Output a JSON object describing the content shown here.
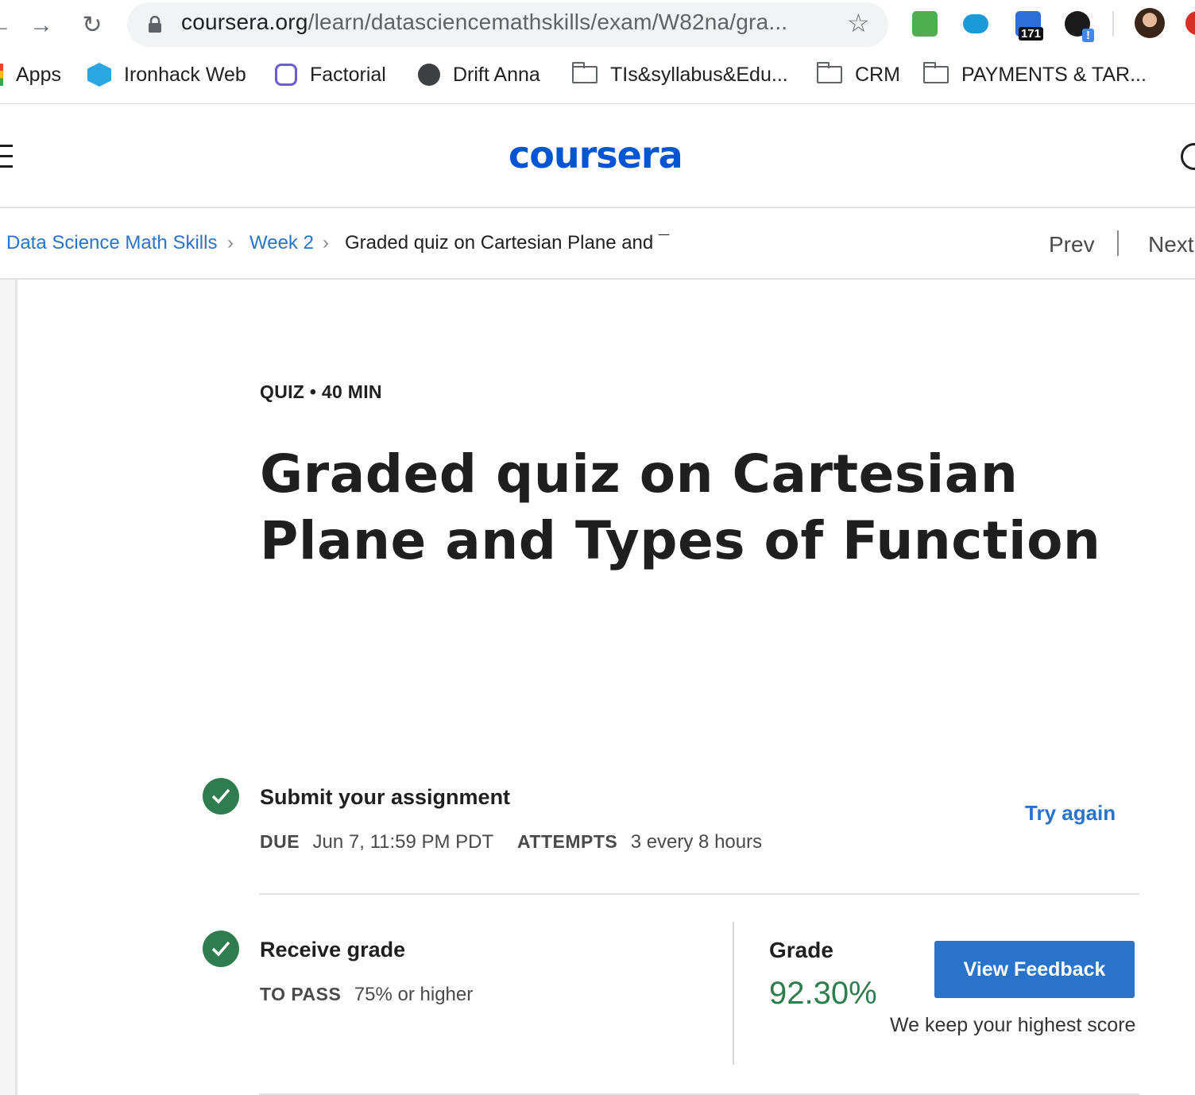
{
  "browser": {
    "url_host": "coursera.org",
    "url_path": "/learn/datasciencemathskills/exam/W82na/gra...",
    "extension_badge": "171",
    "extension_alert": "!",
    "bookmarks": [
      {
        "label": "Apps",
        "icon": "apps-grid-icon"
      },
      {
        "label": "Ironhack Web",
        "icon": "ironhack-icon"
      },
      {
        "label": "Factorial",
        "icon": "factorial-icon"
      },
      {
        "label": "Drift Anna",
        "icon": "globe-icon"
      },
      {
        "label": "TIs&syllabus&Edu...",
        "icon": "folder-icon"
      },
      {
        "label": "CRM",
        "icon": "folder-icon"
      },
      {
        "label": "PAYMENTS & TAR...",
        "icon": "folder-icon"
      }
    ]
  },
  "header": {
    "logo": "coursera"
  },
  "breadcrumb": {
    "course": "Data Science Math Skills",
    "week": "Week 2",
    "current": "Graded quiz on Cartesian Plane and ¯",
    "prev": "Prev",
    "next": "Next"
  },
  "quiz": {
    "kicker": "QUIZ • 40 MIN",
    "title": "Graded quiz on Cartesian Plane and Types of Function"
  },
  "submit": {
    "heading": "Submit your assignment",
    "due_label": "DUE",
    "due_value": "Jun 7, 11:59 PM PDT",
    "attempts_label": "ATTEMPTS",
    "attempts_value": "3 every 8 hours",
    "try_again": "Try again"
  },
  "receive": {
    "heading": "Receive grade",
    "pass_label": "TO PASS",
    "pass_value": "75% or higher",
    "grade_label": "Grade",
    "grade_value": "92.30%",
    "view_feedback": "View Feedback",
    "keep_note": "We keep your highest score"
  },
  "colors": {
    "brand": "#0056d2",
    "link": "#2a73cc",
    "success": "#2f7d4e"
  }
}
